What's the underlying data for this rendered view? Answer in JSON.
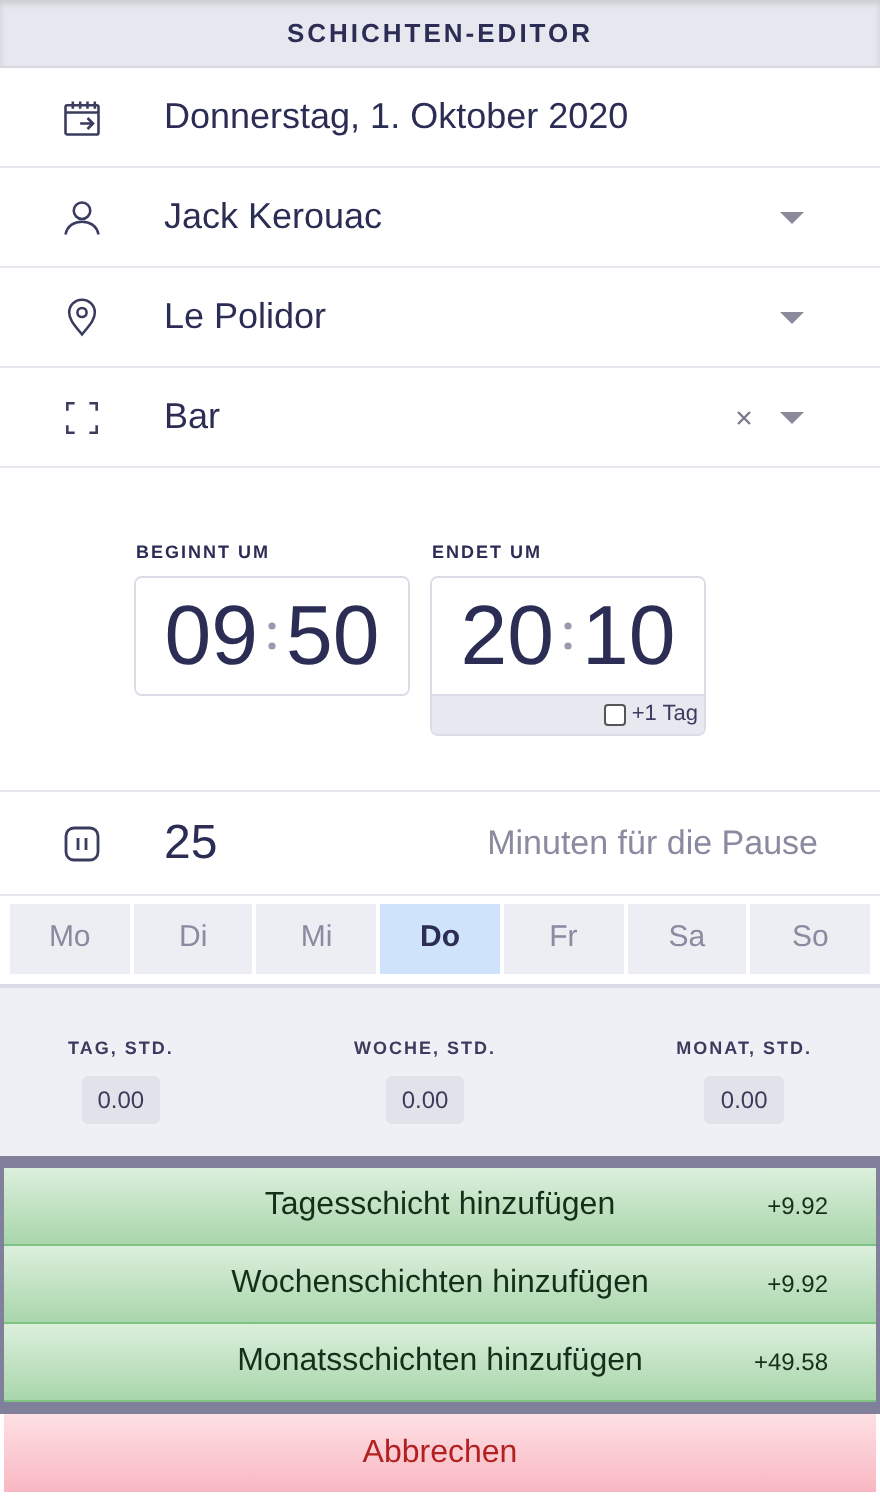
{
  "header": {
    "title": "SCHICHTEN-EDITOR"
  },
  "fields": [
    {
      "kind": "date",
      "value": "Donnerstag, 1. Oktober 2020",
      "dropdown": false,
      "clearable": false
    },
    {
      "kind": "person",
      "value": "Jack Kerouac",
      "dropdown": true,
      "clearable": false
    },
    {
      "kind": "location",
      "value": "Le Polidor",
      "dropdown": true,
      "clearable": false
    },
    {
      "kind": "area",
      "value": "Bar",
      "dropdown": true,
      "clearable": true
    }
  ],
  "times": {
    "start": {
      "label": "BEGINNT UM",
      "hours": "09",
      "minutes": "50"
    },
    "end": {
      "label": "ENDET UM",
      "hours": "20",
      "minutes": "10",
      "next_day": {
        "label": "+1 Tag",
        "checked": false
      }
    }
  },
  "pause": {
    "value": "25",
    "label": "Minuten für die Pause"
  },
  "days": [
    {
      "label": "Mo",
      "selected": false
    },
    {
      "label": "Di",
      "selected": false
    },
    {
      "label": "Mi",
      "selected": false
    },
    {
      "label": "Do",
      "selected": true
    },
    {
      "label": "Fr",
      "selected": false
    },
    {
      "label": "Sa",
      "selected": false
    },
    {
      "label": "So",
      "selected": false
    }
  ],
  "totals": [
    {
      "label": "TAG, STD.",
      "value": "0.00"
    },
    {
      "label": "WOCHE, STD.",
      "value": "0.00"
    },
    {
      "label": "MONAT, STD.",
      "value": "0.00"
    }
  ],
  "actions": [
    {
      "label": "Tagesschicht hinzufügen",
      "hours": "+9.92"
    },
    {
      "label": "Wochenschichten hinzufügen",
      "hours": "+9.92"
    },
    {
      "label": "Monatsschichten hinzufügen",
      "hours": "+49.58"
    }
  ],
  "cancel": {
    "label": "Abbrechen"
  }
}
